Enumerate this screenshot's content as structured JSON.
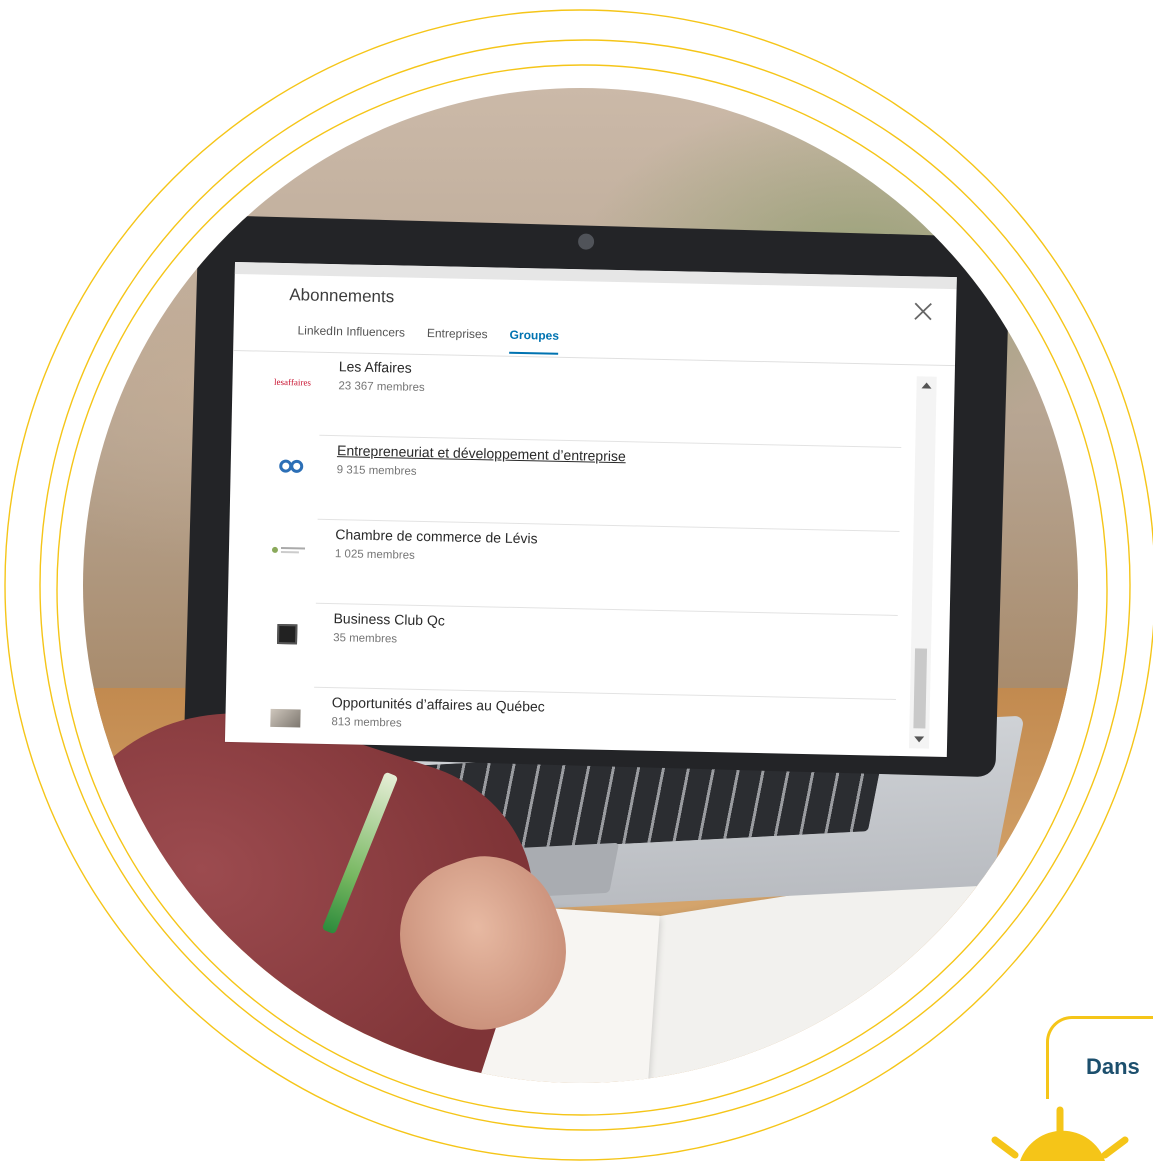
{
  "modal": {
    "title": "Abonnements",
    "tabs": [
      {
        "label": "LinkedIn Influencers"
      },
      {
        "label": "Entreprises"
      },
      {
        "label": "Groupes"
      }
    ]
  },
  "groups": [
    {
      "name": "Les Affaires",
      "members": "23 367 membres",
      "logo": "les-affaires-logo",
      "logo_text": "lesaffaires"
    },
    {
      "name": "Entrepreneuriat et développement d’entreprise",
      "members": "9 315 membres",
      "logo": "gears-logo"
    },
    {
      "name": "Chambre de commerce de Lévis",
      "members": "1 025 membres",
      "logo": "chamber-logo"
    },
    {
      "name": "Business Club Qc",
      "members": "35 membres",
      "logo": "square-logo"
    },
    {
      "name": "Opportunités d’affaires au Québec",
      "members": "813 membres",
      "logo": "handshake-logo"
    }
  ],
  "banner": {
    "text": "Dans"
  },
  "colors": {
    "accent_tab": "#0073b1",
    "ring": "#f5c518",
    "banner_text": "#1c4f6d"
  }
}
